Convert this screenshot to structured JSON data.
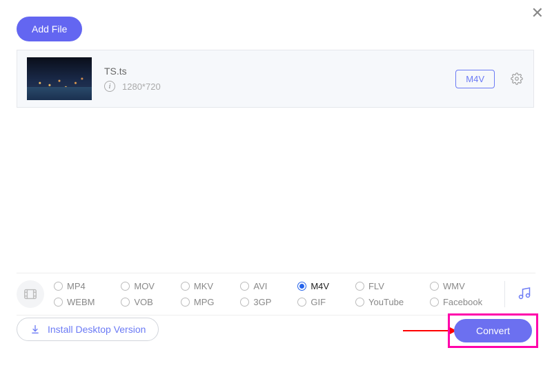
{
  "close": "✕",
  "add_file_label": "Add File",
  "file": {
    "name": "TS.ts",
    "resolution": "1280*720",
    "target_format": "M4V"
  },
  "formats": [
    {
      "label": "MP4",
      "selected": false
    },
    {
      "label": "MOV",
      "selected": false
    },
    {
      "label": "MKV",
      "selected": false
    },
    {
      "label": "AVI",
      "selected": false
    },
    {
      "label": "M4V",
      "selected": true
    },
    {
      "label": "FLV",
      "selected": false
    },
    {
      "label": "WMV",
      "selected": false
    },
    {
      "label": "WEBM",
      "selected": false
    },
    {
      "label": "VOB",
      "selected": false
    },
    {
      "label": "MPG",
      "selected": false
    },
    {
      "label": "3GP",
      "selected": false
    },
    {
      "label": "GIF",
      "selected": false
    },
    {
      "label": "YouTube",
      "selected": false
    },
    {
      "label": "Facebook",
      "selected": false
    }
  ],
  "install_label": "Install Desktop Version",
  "convert_label": "Convert"
}
